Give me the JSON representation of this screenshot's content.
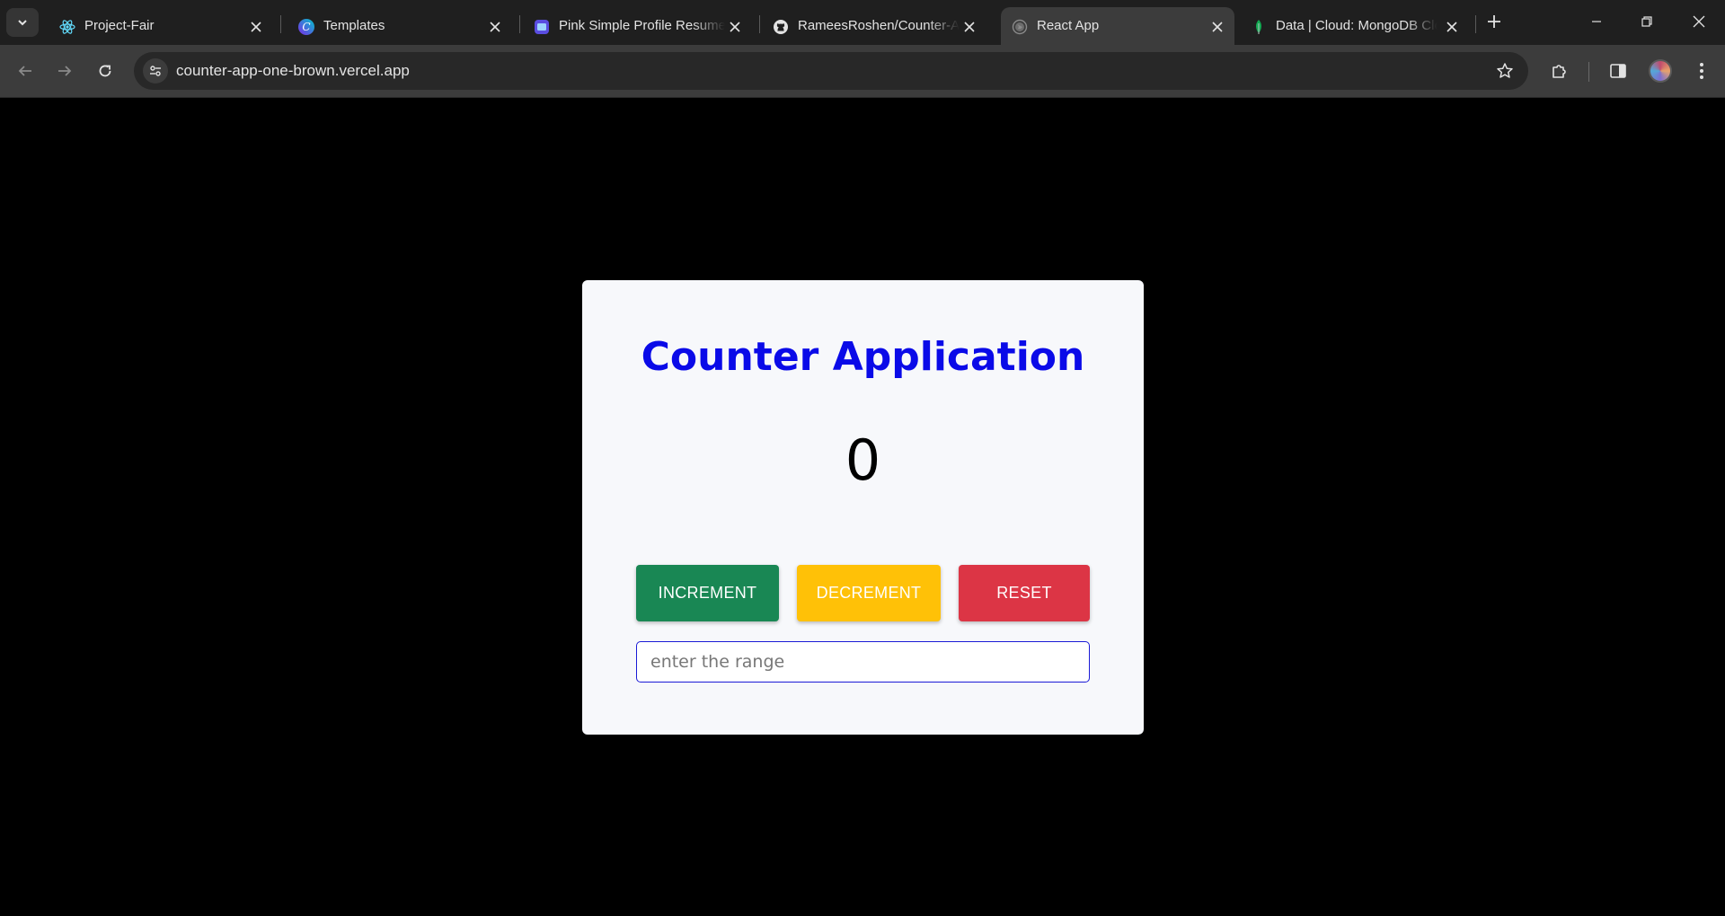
{
  "browser": {
    "tabs": [
      {
        "title": "Project-Fair",
        "favicon": "react-icon"
      },
      {
        "title": "Templates",
        "favicon": "canva-icon"
      },
      {
        "title": "Pink Simple Profile Resume",
        "favicon": "canva-doc-icon"
      },
      {
        "title": "RameesRoshen/Counter-App",
        "favicon": "github-icon"
      },
      {
        "title": "React App",
        "favicon": "globe-icon",
        "active": true
      },
      {
        "title": "Data | Cloud: MongoDB Cloud",
        "favicon": "mongodb-leaf-icon"
      }
    ],
    "url": "counter-app-one-brown.vercel.app"
  },
  "app": {
    "title": "Counter Application",
    "count": "0",
    "buttons": {
      "increment": "INCREMENT",
      "decrement": "DECREMENT",
      "reset": "RESET"
    },
    "range_placeholder": "enter the range"
  },
  "colors": {
    "title": "#0a0ae8",
    "increment": "#198754",
    "decrement": "#ffc107",
    "reset": "#dc3545",
    "card": "#f7f8fb",
    "page_bg": "#000000"
  }
}
